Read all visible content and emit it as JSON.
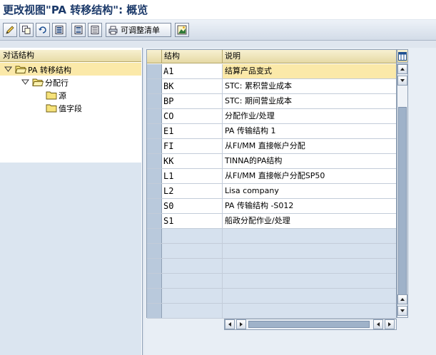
{
  "window": {
    "title": "更改视图\"PA 转移结构\": 概览"
  },
  "toolbar": {
    "buttons": [
      {
        "icon": "edit-icon"
      },
      {
        "icon": "copy-icon"
      },
      {
        "icon": "undo-icon"
      },
      {
        "icon": "select-all-icon"
      },
      {
        "icon": "select-block-icon"
      },
      {
        "icon": "deselect-all-icon"
      }
    ],
    "text_button_icon": "print-icon",
    "text_button_label": "可调整清单",
    "last_icon": "info-icon"
  },
  "tree": {
    "header": "对话结构",
    "items": [
      {
        "label": "PA 转移结构",
        "level": 0,
        "expanded": true,
        "selected": true
      },
      {
        "label": "分配行",
        "level": 1,
        "expanded": true,
        "selected": false
      },
      {
        "label": "源",
        "level": 2,
        "expanded": false,
        "selected": false
      },
      {
        "label": "值字段",
        "level": 2,
        "expanded": false,
        "selected": false
      }
    ]
  },
  "table": {
    "columns": [
      "结构",
      "说明"
    ],
    "rows": [
      {
        "code": "A1",
        "desc": "结算产品变式"
      },
      {
        "code": "BK",
        "desc": "STC: 累积营业成本"
      },
      {
        "code": "BP",
        "desc": "STC: 期间营业成本"
      },
      {
        "code": "CO",
        "desc": "分配作业/处理"
      },
      {
        "code": "E1",
        "desc": "PA 传输结构 1"
      },
      {
        "code": "FI",
        "desc": "从FI/MM 直接帐户分配"
      },
      {
        "code": "KK",
        "desc": "TINNA的PA结构"
      },
      {
        "code": "L1",
        "desc": "从FI/MM 直接帐户分配SP50"
      },
      {
        "code": "L2",
        "desc": "Lisa company"
      },
      {
        "code": "S0",
        "desc": "PA 传输结构 -S012"
      },
      {
        "code": "S1",
        "desc": "船政分配作业/处理"
      }
    ],
    "empty_rows": 6,
    "active_row": 0
  },
  "colors": {
    "title": "#1c3a6a",
    "header_bg": "#e6d9a5",
    "selected_bg": "#fbe9a9",
    "sel_column": "#b9c9dc"
  }
}
